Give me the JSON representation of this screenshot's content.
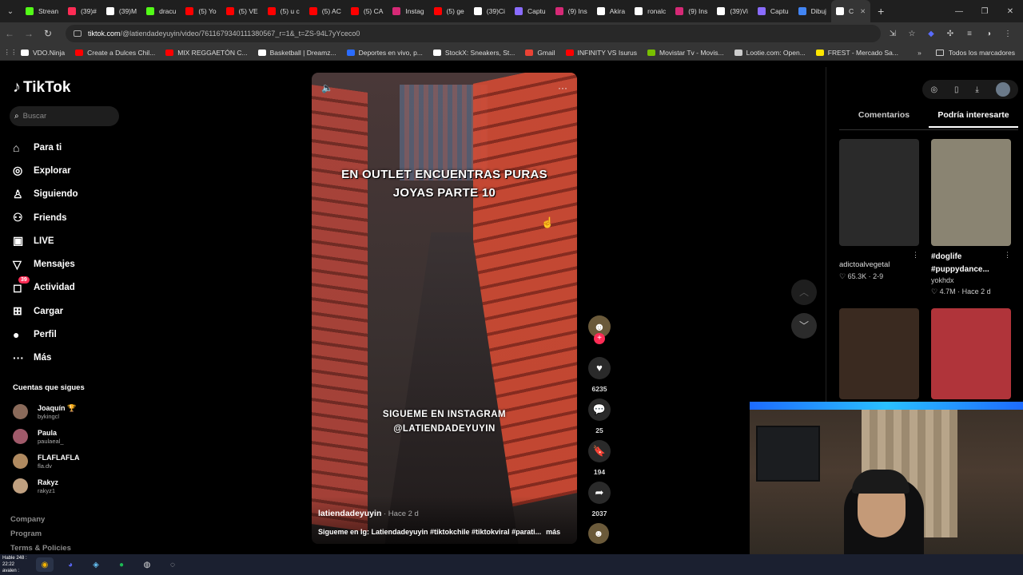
{
  "browser": {
    "tabs": [
      {
        "label": "Strean",
        "color": "#53fc18"
      },
      {
        "label": "(39)#",
        "color": "#fe2c55"
      },
      {
        "label": "(39)M",
        "color": "#ffffff"
      },
      {
        "label": "dracu",
        "color": "#53fc18"
      },
      {
        "label": "(5) Yo",
        "color": "#ff0000"
      },
      {
        "label": "(5) VE",
        "color": "#ff0000"
      },
      {
        "label": "(5) u c",
        "color": "#ff0000"
      },
      {
        "label": "(5) AC",
        "color": "#ff0000"
      },
      {
        "label": "(5) CA",
        "color": "#ff0000"
      },
      {
        "label": "Instag",
        "color": "#d62976"
      },
      {
        "label": "(5) ge",
        "color": "#ff0000"
      },
      {
        "label": "(39)Ci",
        "color": "#ffffff"
      },
      {
        "label": "Captu",
        "color": "#8a6cff"
      },
      {
        "label": "(9) Ins",
        "color": "#d62976"
      },
      {
        "label": "Akira",
        "color": "#ffffff"
      },
      {
        "label": "ronalc",
        "color": "#ffffff"
      },
      {
        "label": "(9) Ins",
        "color": "#d62976"
      },
      {
        "label": "(39)Vi",
        "color": "#ffffff"
      },
      {
        "label": "Captu",
        "color": "#8a6cff"
      },
      {
        "label": "Dibuj",
        "color": "#4285f4"
      },
      {
        "label": "C",
        "color": "#ffffff"
      }
    ],
    "new_tab": "+",
    "url_host": "tiktok.com",
    "url_path": "/@latiendadeyuyin/video/7611679340111380567_r=1&_t=ZS-94L7yYceco0",
    "bookmarks": [
      {
        "label": "VDO.Ninja",
        "color": "#ffffff"
      },
      {
        "label": "Create a Dulces Chil...",
        "color": "#ff0000"
      },
      {
        "label": "MIX REGGAETÓN C...",
        "color": "#ff0000"
      },
      {
        "label": "Basketball | Dreamz...",
        "color": "#ffffff"
      },
      {
        "label": "Deportes en vivo, p...",
        "color": "#2a6cff"
      },
      {
        "label": "StockX: Sneakers, St...",
        "color": "#ffffff"
      },
      {
        "label": "Gmail",
        "color": "#ea4335"
      },
      {
        "label": "INFINITY VS Isurus",
        "color": "#ff0000"
      },
      {
        "label": "Movistar Tv - Movis...",
        "color": "#79c000"
      },
      {
        "label": "Lootie.com: Open...",
        "color": "#cccccc"
      },
      {
        "label": "FREST - Mercado Sa...",
        "color": "#ffe600"
      }
    ],
    "more_bookmarks": "»",
    "all_bookmarks": "Todos los marcadores"
  },
  "sidebar": {
    "logo": "TikTok",
    "search_placeholder": "Buscar",
    "menu": [
      {
        "label": "Para ti",
        "icon": "⌂"
      },
      {
        "label": "Explorar",
        "icon": "◎"
      },
      {
        "label": "Siguiendo",
        "icon": "♙"
      },
      {
        "label": "Friends",
        "icon": "⚇"
      },
      {
        "label": "LIVE",
        "icon": "▣"
      },
      {
        "label": "Mensajes",
        "icon": "▽"
      },
      {
        "label": "Actividad",
        "icon": "◻",
        "badge": "39"
      },
      {
        "label": "Cargar",
        "icon": "⊞"
      },
      {
        "label": "Perfil",
        "icon": "●"
      },
      {
        "label": "Más",
        "icon": "···"
      }
    ],
    "following_title": "Cuentas que sigues",
    "following": [
      {
        "name": "Joaquín 🏆",
        "handle": "bykingcl",
        "color": "#8a6a5a"
      },
      {
        "name": "Paula",
        "handle": "paulaeal_",
        "color": "#a05a6a"
      },
      {
        "name": "FLAFLAFLA",
        "handle": "fla.dv",
        "color": "#b08a60"
      },
      {
        "name": "Rakyz",
        "handle": "rakyz1",
        "color": "#c0a080"
      }
    ],
    "footer": [
      "Company",
      "Program",
      "Terms & Policies"
    ]
  },
  "video": {
    "overlay_title": "EN OUTLET ENCUENTRAS PURAS JOYAS PARTE 10",
    "overlay_instagram": "SIGUEME EN INSTAGRAM @LATIENDADEYUYIN",
    "author": "latiendadeyuyin",
    "time": " · Hace 2 d",
    "description": "Sigueme en Ig: Latiendadeyuyin #tiktokchile #tiktokviral #parati...",
    "more": "más",
    "likes": "6235",
    "comments": "25",
    "saves": "194",
    "shares": "2037"
  },
  "right_panel": {
    "tabs": [
      "Comentarios",
      "Podría interesarte"
    ],
    "active_tab": 1,
    "cards": [
      {
        "name": "adictoalvegetal",
        "title": "",
        "user": "",
        "stats": "♡ 65.3K · 2-9",
        "color": "#2a2a2a"
      },
      {
        "name": "",
        "title": "#doglife #puppydance...",
        "user": "yokhdx",
        "stats": "♡ 4.7M · Hace 2 d",
        "color": "#8a8472"
      },
      {
        "name": "",
        "title": "",
        "user": "",
        "stats": "",
        "color": "#3a2a20"
      },
      {
        "name": "",
        "title": "",
        "user": "",
        "stats": "",
        "color": "#b0343a"
      }
    ]
  },
  "taskbar": {
    "info_top": "Hable 248 : 22:22",
    "info_bottom": "avalen :"
  }
}
